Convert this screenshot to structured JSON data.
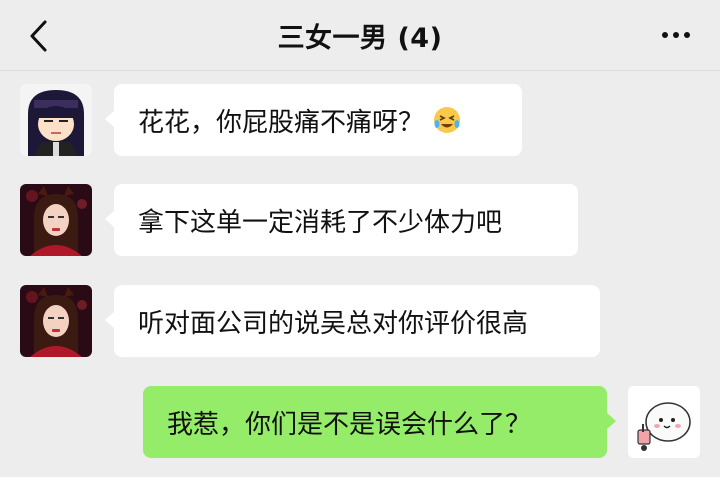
{
  "header": {
    "title": "三女一男 (4)",
    "back_icon": "chevron-left-icon",
    "more_icon": "more-dots-icon"
  },
  "messages": [
    {
      "side": "left",
      "sender_avatar": "anime-girl-avatar",
      "text": "花花，你屁股痛不痛呀？",
      "emoji": "laughing-tears-emoji"
    },
    {
      "side": "left",
      "sender_avatar": "woman-photo-avatar",
      "text": "拿下这单一定消耗了不少体力吧"
    },
    {
      "side": "left",
      "sender_avatar": "woman-photo-avatar",
      "text": "听对面公司的说吴总对你评价很高"
    },
    {
      "side": "right",
      "sender_avatar": "cartoon-bun-avatar",
      "text": "我惹，你们是不是误会什么了？"
    }
  ],
  "colors": {
    "background": "#ededed",
    "bubble_left": "#ffffff",
    "bubble_right": "#95ec69"
  }
}
